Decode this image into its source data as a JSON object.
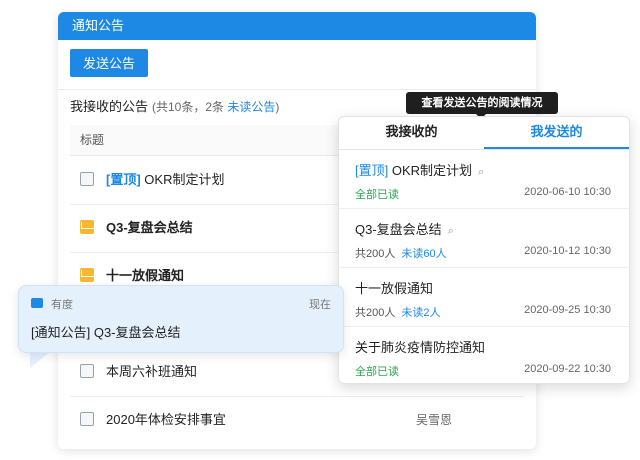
{
  "main": {
    "header_title": "通知公告",
    "send_button": "发送公告",
    "received_label": "我接收的公告",
    "count_text": "(共10条，2条 ",
    "unread_link": "未读公告",
    "count_close": ")",
    "column_title": "标题",
    "rows": [
      {
        "tag": "[置顶]",
        "title": " OKR制定计划",
        "bold": false,
        "icon": "document-icon",
        "author": ""
      },
      {
        "tag": "",
        "title": "Q3-复盘会总结",
        "bold": true,
        "icon": "mail-icon",
        "author": ""
      },
      {
        "tag": "",
        "title": "十一放假通知",
        "bold": true,
        "icon": "mail-icon",
        "author": ""
      },
      {
        "tag": "",
        "title": "",
        "bold": false,
        "icon": "",
        "author": ""
      },
      {
        "tag": "",
        "title": "本周六补班通知",
        "bold": false,
        "icon": "document-icon",
        "author": ""
      },
      {
        "tag": "",
        "title": "2020年体检安排事宜",
        "bold": false,
        "icon": "document-icon",
        "author": "吴雪恩"
      }
    ]
  },
  "tooltip": "查看发送公告的阅读情况",
  "popup": {
    "tab_received": "我接收的",
    "tab_sent": "我发送的",
    "items": [
      {
        "tag": "[置顶]",
        "title": " OKR制定计划",
        "clip": true,
        "status_all": "全部已读",
        "total": "",
        "unread": "",
        "time": "2020-06-10  10:30"
      },
      {
        "tag": "",
        "title": "Q3-复盘会总结",
        "clip": true,
        "status_all": "",
        "total": "共200人",
        "unread": "未读60人",
        "time": "2020-10-12  10:30"
      },
      {
        "tag": "",
        "title": "十一放假通知",
        "clip": false,
        "status_all": "",
        "total": "共200人",
        "unread": "未读2人",
        "time": "2020-09-25  10:30"
      },
      {
        "tag": "",
        "title": "关于肺炎疫情防控通知",
        "clip": false,
        "status_all": "全部已读",
        "total": "",
        "unread": "",
        "time": "2020-09-22  10:30"
      }
    ]
  },
  "toast": {
    "app_name": "有度",
    "time": "现在",
    "message": "[通知公告] Q3-复盘会总结"
  },
  "colors": {
    "accent": "#1e88e5",
    "read_green": "#2ea44f",
    "toast_bg": "#e4f1fd",
    "mail_yellow": "#f7b731"
  }
}
